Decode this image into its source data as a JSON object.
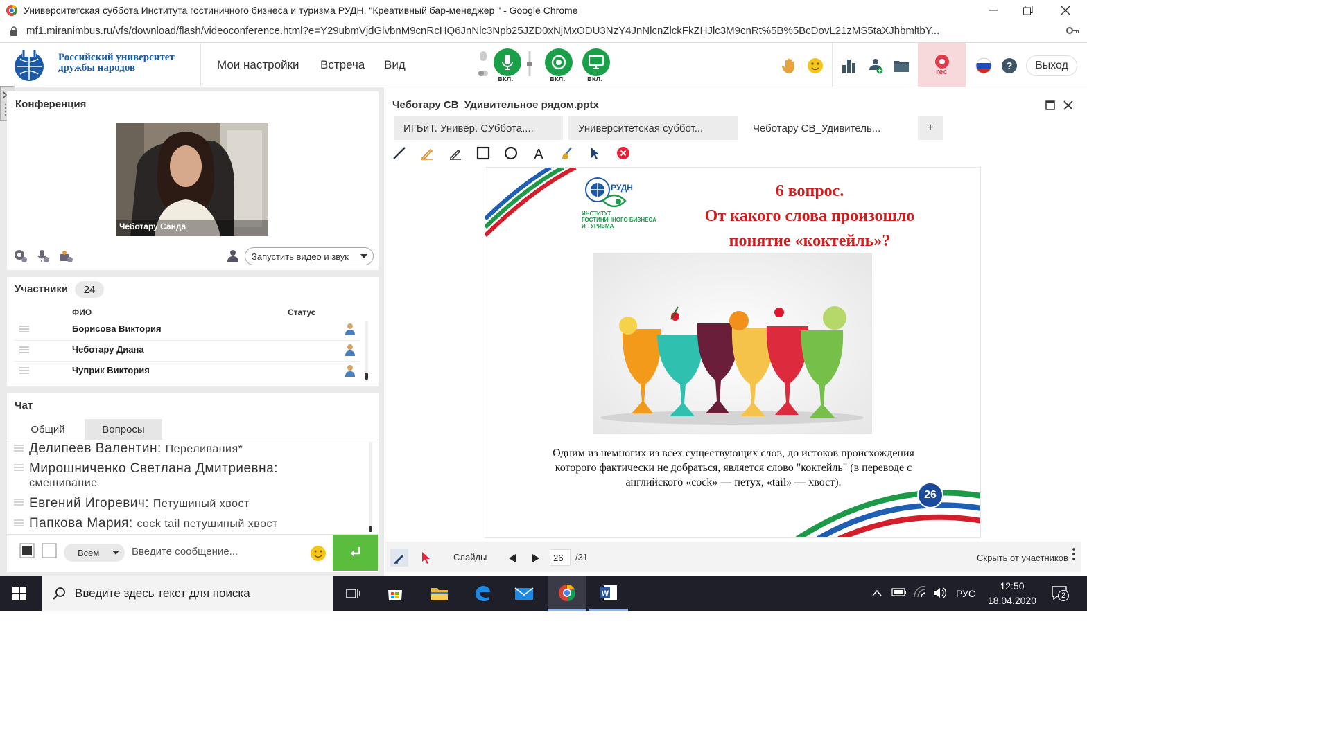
{
  "browser": {
    "window_title": "Университетская суббота Института гостиничного бизнеса и туризма РУДН. \"Креативный бар-менеджер \" - Google Chrome",
    "url": "mf1.miranimbus.ru/vfs/download/flash/videoconference.html?e=Y29ubmVjdGlvbnM9cnRcHQ6JnNlc3Npb25JZD0xNjMxODU3NzY4JnNlcnZlckFkZHJlc3M9cnRt%5B%5BcDovL21zMS5taXJhbmltbY..."
  },
  "header": {
    "logo_line1": "Российский университет",
    "logo_line2": "дружбы народов",
    "menu": [
      "Мои настройки",
      "Встреча",
      "Вид"
    ],
    "mic_label": "вкл.",
    "cam_label": "вкл.",
    "screen_label": "вкл.",
    "rec_label": "rec",
    "exit_label": "Выход"
  },
  "conference": {
    "title": "Конференция",
    "video_name": "Чеботару Санда",
    "start_button": "Запустить видео и звук"
  },
  "participants": {
    "title": "Участники",
    "count": "24",
    "col_name": "ФИО",
    "col_status": "Статус",
    "rows": [
      "Борисова Виктория",
      "Чеботару  Диана",
      "Чуприк Виктория"
    ]
  },
  "chat": {
    "title": "Чат",
    "tabs": [
      "Общий",
      "Вопросы"
    ],
    "messages": [
      {
        "author": "Делипеев Валентин:",
        "text": "Переливания*"
      },
      {
        "author": "Мирошниченко Светлана  Дмитриевна:",
        "text": "смешивание"
      },
      {
        "author": "Евгений  Игоревич:",
        "text": "Петушиный хвост"
      },
      {
        "author": "Папкова Мария:",
        "text": "cock tail петушиный хвост"
      }
    ],
    "recipient": "Всем",
    "placeholder": "Введите сообщение..."
  },
  "presentation": {
    "file_title": "Чеботару СВ_Удивительное рядом.pptx",
    "tabs": [
      "ИГБиТ. Универ. СУббота....",
      "Университетская суббот...",
      "Чеботару СВ_Удивитель...",
      "+"
    ],
    "slide": {
      "logo_text": "РУДН",
      "institute": [
        "ИНСТИТУТ",
        "ГОСТИНИЧНОГО БИЗНЕСА",
        "И ТУРИЗМА"
      ],
      "title1": "6 вопрос.",
      "title2": "От какого слова произошло",
      "title3": "понятие «коктейль»?",
      "body1": "Одним из немногих из всех существующих слов, до истоков происхождения",
      "body2": "которого фактически не добраться, является слово \"коктейль\" (в переводе с",
      "body3": "английского «cock» — петух, «tail» — хвост).",
      "number": "26"
    },
    "footer": {
      "slides_label": "Слайды",
      "current": "26",
      "total": "/31",
      "hide_label": "Скрыть от участников"
    }
  },
  "taskbar": {
    "search_placeholder": "Введите здесь текст для поиска",
    "lang": "РУС",
    "time": "12:50",
    "date": "18.04.2020",
    "notifications": "2"
  },
  "colors": {
    "accent_green": "#1aa049",
    "rudn_blue": "#1b5aa6",
    "slide_red": "#cc1f1f",
    "rec_bg": "#f7d9dc"
  }
}
